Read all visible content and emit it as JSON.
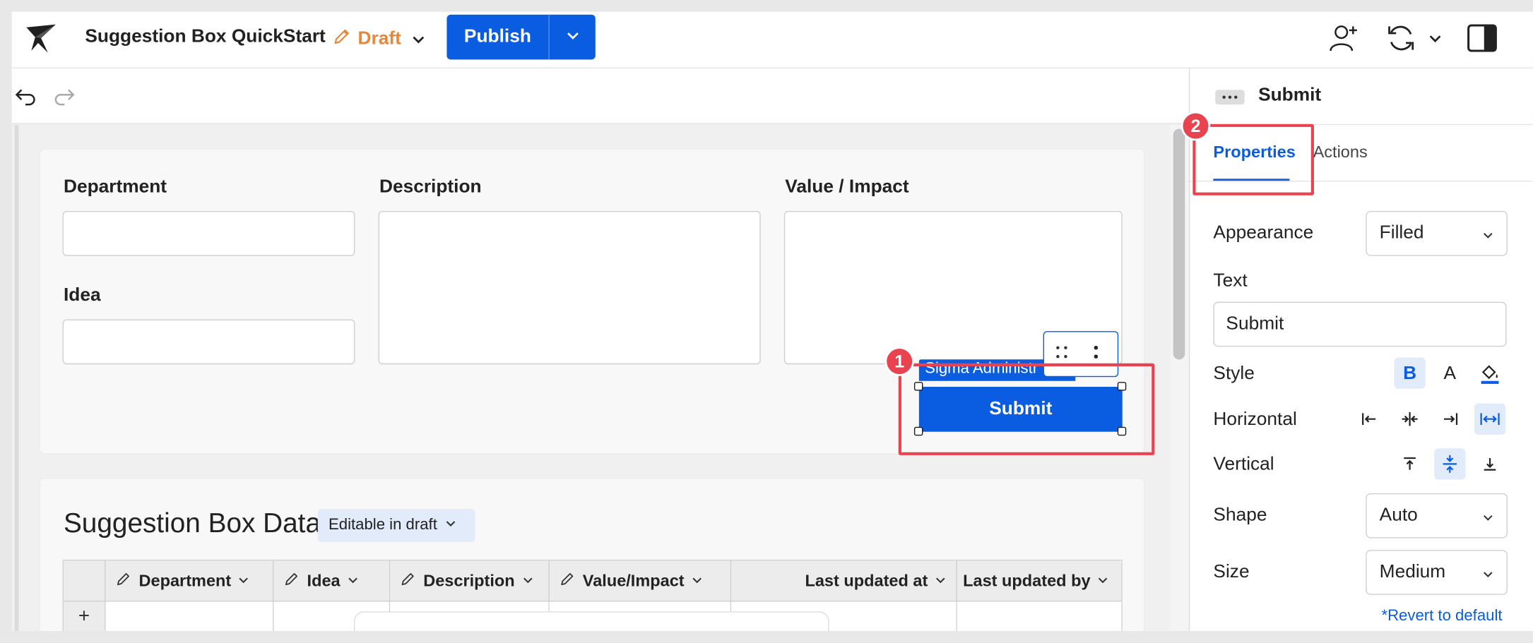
{
  "header": {
    "doc_title": "Suggestion Box QuickStart",
    "status": "Draft",
    "publish_label": "Publish"
  },
  "form": {
    "department_label": "Department",
    "idea_label": "Idea",
    "description_label": "Description",
    "value_label": "Value / Impact",
    "user_tag": "Sigma Administr",
    "submit_label": "Submit",
    "badge1": "1"
  },
  "table": {
    "title": "Suggestion Box Data",
    "badge": "Editable in draft",
    "columns": [
      "Department",
      "Idea",
      "Description",
      "Value/Impact",
      "Last updated at",
      "Last updated by"
    ],
    "add_row": "+"
  },
  "panel": {
    "element_name": "Submit",
    "badge2": "2",
    "tabs": [
      "Properties",
      "Actions"
    ],
    "appearance_label": "Appearance",
    "appearance_value": "Filled",
    "text_label": "Text",
    "text_value": "Submit",
    "style_label": "Style",
    "horizontal_label": "Horizontal",
    "vertical_label": "Vertical",
    "shape_label": "Shape",
    "shape_value": "Auto",
    "size_label": "Size",
    "size_value": "Medium",
    "revert_link": "*Revert to default"
  },
  "colors": {
    "accent": "#0a5ce0",
    "draft": "#e8873a",
    "callout": "#e8434f"
  }
}
